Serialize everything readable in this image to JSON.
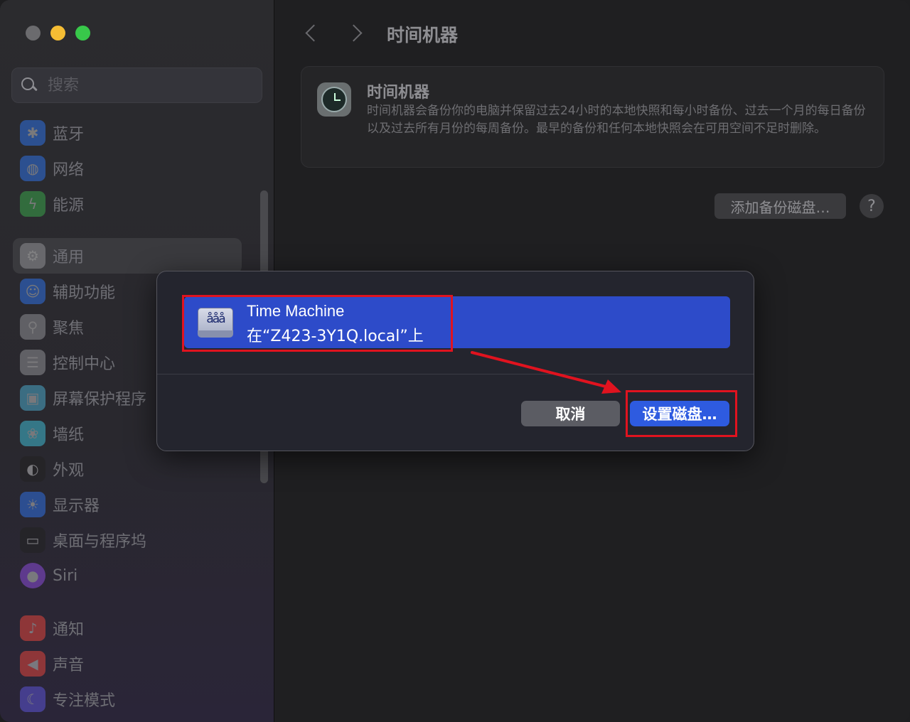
{
  "window": {
    "traffic_lights": [
      "close",
      "minimize",
      "maximize"
    ]
  },
  "sidebar": {
    "search_placeholder": "搜索",
    "items": [
      {
        "label": "蓝牙",
        "icon": "bluetooth-icon",
        "color": "#2f6fe0"
      },
      {
        "label": "网络",
        "icon": "globe-icon",
        "color": "#2f6fe0"
      },
      {
        "label": "能源",
        "icon": "bolt-icon",
        "color": "#3aa34a"
      },
      {
        "label": "通用",
        "icon": "gear-icon",
        "color": "#8e8e93"
      },
      {
        "label": "辅助功能",
        "icon": "accessibility-icon",
        "color": "#2f6fe0"
      },
      {
        "label": "聚焦",
        "icon": "magnifier-icon",
        "color": "#8e8e93"
      },
      {
        "label": "控制中心",
        "icon": "toggles-icon",
        "color": "#8e8e93"
      },
      {
        "label": "屏幕保护程序",
        "icon": "screensaver-icon",
        "color": "#4aa6c8"
      },
      {
        "label": "墙纸",
        "icon": "flower-icon",
        "color": "#3fb8d0"
      },
      {
        "label": "外观",
        "icon": "appearance-icon",
        "color": "#222222"
      },
      {
        "label": "显示器",
        "icon": "sun-icon",
        "color": "#2f6fe0"
      },
      {
        "label": "桌面与程序坞",
        "icon": "dock-icon",
        "color": "#222222"
      },
      {
        "label": "Siri",
        "icon": "siri-icon",
        "color": "#8a4bd8"
      },
      {
        "label": "通知",
        "icon": "bell-icon",
        "color": "#e0443c"
      },
      {
        "label": "声音",
        "icon": "speaker-icon",
        "color": "#e0443c"
      },
      {
        "label": "专注模式",
        "icon": "moon-icon",
        "color": "#5b55d6"
      }
    ]
  },
  "main": {
    "title": "时间机器",
    "card": {
      "title": "时间机器",
      "description": "时间机器会备份你的电脑并保留过去24小时的本地快照和每小时备份、过去一个月的每日备份以及过去所有月份的每周备份。最早的备份和任何本地快照会在可用空间不足时删除。"
    },
    "add_disk_label": "添加备份磁盘…",
    "help_label": "?"
  },
  "dialog": {
    "disk_name": "Time Machine",
    "disk_location": "在“Z423-3Y1Q.local”上",
    "cancel_label": "取消",
    "setup_label": "设置磁盘…"
  },
  "colors": {
    "selection": "#2d4bc9",
    "primary_button": "#2e5be0",
    "annotation": "#e0131f"
  }
}
